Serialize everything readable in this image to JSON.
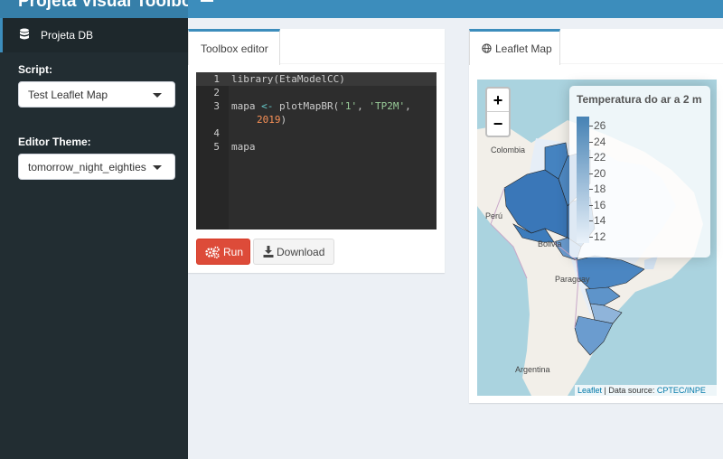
{
  "app": {
    "title": "Projeta Visual Toolbox"
  },
  "sidebar": {
    "active_item": "Projeta DB",
    "script_label": "Script:",
    "script_value": "Test Leaflet Map",
    "theme_label": "Editor Theme:",
    "theme_value": "tomorrow_night_eighties"
  },
  "editor": {
    "tab": "Toolbox editor",
    "line_numbers": [
      "1",
      "2",
      "3",
      "4",
      "5"
    ],
    "code": {
      "l1": "library(EtaModelCC)",
      "l3a": "mapa ",
      "l3op": "<-",
      "l3b": " plotMapBR(",
      "l3s1": "'1'",
      "l3c": ", ",
      "l3s2": "'TP2M'",
      "l3d": ",",
      "l3num": "2019",
      "l3e": ")",
      "l5": "mapa"
    },
    "run_label": "Run",
    "download_label": "Download"
  },
  "map": {
    "tab": "Leaflet Map",
    "zoom_in": "+",
    "zoom_out": "−",
    "legend_title": "Temperatura do ar a 2 m",
    "legend_ticks": [
      "26",
      "24",
      "22",
      "20",
      "18",
      "16",
      "14",
      "12"
    ],
    "labels": {
      "colombia": "Colombia",
      "peru": "Perú",
      "bolivia": "Bolivia",
      "paraguay": "Paraguay",
      "argentina": "Argentina"
    },
    "attribution_leaflet": "Leaflet",
    "attribution_sep": " | Data source: ",
    "attribution_source": "CPTEC/INPE"
  },
  "colors": {
    "header": "#3c8dbc",
    "sidebar": "#222d32",
    "run": "#dd4b39",
    "choropleth_high": "#4682b4",
    "choropleth_low": "#eaf2fa"
  }
}
